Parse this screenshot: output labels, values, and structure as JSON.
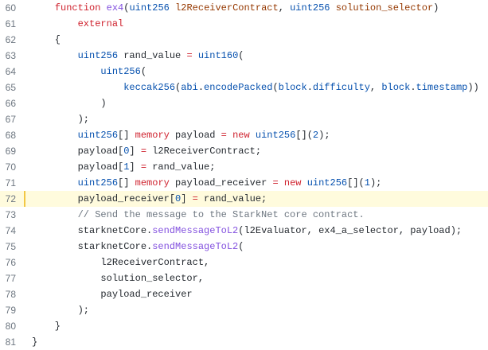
{
  "colors": {
    "keyword": "#cf222e",
    "type": "#0550ae",
    "function": "#8250df",
    "parameter": "#953800",
    "comment": "#6e7781",
    "plain": "#24292f",
    "line_number": "#6e7781",
    "highlight_background": "#fffbdd",
    "highlight_marker": "#f2c744"
  },
  "highlighted_line": "72",
  "lines": [
    {
      "num": "60",
      "tokens": [
        {
          "t": "    ",
          "c": "plain"
        },
        {
          "t": "function",
          "c": "keyword"
        },
        {
          "t": " ",
          "c": "plain"
        },
        {
          "t": "ex4",
          "c": "fn"
        },
        {
          "t": "(",
          "c": "plain"
        },
        {
          "t": "uint256",
          "c": "type"
        },
        {
          "t": " ",
          "c": "plain"
        },
        {
          "t": "l2ReceiverContract",
          "c": "param"
        },
        {
          "t": ", ",
          "c": "plain"
        },
        {
          "t": "uint256",
          "c": "type"
        },
        {
          "t": " ",
          "c": "plain"
        },
        {
          "t": "solution_selector",
          "c": "param"
        },
        {
          "t": ")",
          "c": "plain"
        }
      ]
    },
    {
      "num": "61",
      "tokens": [
        {
          "t": "        ",
          "c": "plain"
        },
        {
          "t": "external",
          "c": "keyword"
        }
      ]
    },
    {
      "num": "62",
      "tokens": [
        {
          "t": "    {",
          "c": "plain"
        }
      ]
    },
    {
      "num": "63",
      "tokens": [
        {
          "t": "        ",
          "c": "plain"
        },
        {
          "t": "uint256",
          "c": "type"
        },
        {
          "t": " rand_value ",
          "c": "plain"
        },
        {
          "t": "=",
          "c": "op"
        },
        {
          "t": " ",
          "c": "plain"
        },
        {
          "t": "uint160",
          "c": "type"
        },
        {
          "t": "(",
          "c": "plain"
        }
      ]
    },
    {
      "num": "64",
      "tokens": [
        {
          "t": "            ",
          "c": "plain"
        },
        {
          "t": "uint256",
          "c": "type"
        },
        {
          "t": "(",
          "c": "plain"
        }
      ]
    },
    {
      "num": "65",
      "tokens": [
        {
          "t": "                ",
          "c": "plain"
        },
        {
          "t": "keccak256",
          "c": "type"
        },
        {
          "t": "(",
          "c": "plain"
        },
        {
          "t": "abi",
          "c": "prop"
        },
        {
          "t": ".",
          "c": "plain"
        },
        {
          "t": "encodePacked",
          "c": "prop"
        },
        {
          "t": "(",
          "c": "plain"
        },
        {
          "t": "block",
          "c": "prop"
        },
        {
          "t": ".",
          "c": "plain"
        },
        {
          "t": "difficulty",
          "c": "prop"
        },
        {
          "t": ", ",
          "c": "plain"
        },
        {
          "t": "block",
          "c": "prop"
        },
        {
          "t": ".",
          "c": "plain"
        },
        {
          "t": "timestamp",
          "c": "prop"
        },
        {
          "t": "))",
          "c": "plain"
        }
      ]
    },
    {
      "num": "66",
      "tokens": [
        {
          "t": "            )",
          "c": "plain"
        }
      ]
    },
    {
      "num": "67",
      "tokens": [
        {
          "t": "        );",
          "c": "plain"
        }
      ]
    },
    {
      "num": "68",
      "tokens": [
        {
          "t": "        ",
          "c": "plain"
        },
        {
          "t": "uint256",
          "c": "type"
        },
        {
          "t": "[] ",
          "c": "plain"
        },
        {
          "t": "memory",
          "c": "keyword"
        },
        {
          "t": " payload ",
          "c": "plain"
        },
        {
          "t": "=",
          "c": "op"
        },
        {
          "t": " ",
          "c": "plain"
        },
        {
          "t": "new",
          "c": "keyword"
        },
        {
          "t": " ",
          "c": "plain"
        },
        {
          "t": "uint256",
          "c": "type"
        },
        {
          "t": "[](",
          "c": "plain"
        },
        {
          "t": "2",
          "c": "num"
        },
        {
          "t": ");",
          "c": "plain"
        }
      ]
    },
    {
      "num": "69",
      "tokens": [
        {
          "t": "        payload[",
          "c": "plain"
        },
        {
          "t": "0",
          "c": "num"
        },
        {
          "t": "] ",
          "c": "plain"
        },
        {
          "t": "=",
          "c": "op"
        },
        {
          "t": " l2ReceiverContract;",
          "c": "plain"
        }
      ]
    },
    {
      "num": "70",
      "tokens": [
        {
          "t": "        payload[",
          "c": "plain"
        },
        {
          "t": "1",
          "c": "num"
        },
        {
          "t": "] ",
          "c": "plain"
        },
        {
          "t": "=",
          "c": "op"
        },
        {
          "t": " rand_value;",
          "c": "plain"
        }
      ]
    },
    {
      "num": "71",
      "tokens": [
        {
          "t": "        ",
          "c": "plain"
        },
        {
          "t": "uint256",
          "c": "type"
        },
        {
          "t": "[] ",
          "c": "plain"
        },
        {
          "t": "memory",
          "c": "keyword"
        },
        {
          "t": " payload_receiver ",
          "c": "plain"
        },
        {
          "t": "=",
          "c": "op"
        },
        {
          "t": " ",
          "c": "plain"
        },
        {
          "t": "new",
          "c": "keyword"
        },
        {
          "t": " ",
          "c": "plain"
        },
        {
          "t": "uint256",
          "c": "type"
        },
        {
          "t": "[](",
          "c": "plain"
        },
        {
          "t": "1",
          "c": "num"
        },
        {
          "t": ");",
          "c": "plain"
        }
      ]
    },
    {
      "num": "72",
      "tokens": [
        {
          "t": "        payload_receiver[",
          "c": "plain"
        },
        {
          "t": "0",
          "c": "num"
        },
        {
          "t": "] ",
          "c": "plain"
        },
        {
          "t": "=",
          "c": "op"
        },
        {
          "t": " rand_value;",
          "c": "plain"
        }
      ]
    },
    {
      "num": "73",
      "tokens": [
        {
          "t": "        ",
          "c": "plain"
        },
        {
          "t": "// Send the message to the StarkNet core contract.",
          "c": "comment"
        }
      ]
    },
    {
      "num": "74",
      "tokens": [
        {
          "t": "        starknetCore.",
          "c": "plain"
        },
        {
          "t": "sendMessageToL2",
          "c": "fn"
        },
        {
          "t": "(l2Evaluator, ex4_a_selector, payload);",
          "c": "plain"
        }
      ]
    },
    {
      "num": "75",
      "tokens": [
        {
          "t": "        starknetCore.",
          "c": "plain"
        },
        {
          "t": "sendMessageToL2",
          "c": "fn"
        },
        {
          "t": "(",
          "c": "plain"
        }
      ]
    },
    {
      "num": "76",
      "tokens": [
        {
          "t": "            l2ReceiverContract,",
          "c": "plain"
        }
      ]
    },
    {
      "num": "77",
      "tokens": [
        {
          "t": "            solution_selector,",
          "c": "plain"
        }
      ]
    },
    {
      "num": "78",
      "tokens": [
        {
          "t": "            payload_receiver",
          "c": "plain"
        }
      ]
    },
    {
      "num": "79",
      "tokens": [
        {
          "t": "        );",
          "c": "plain"
        }
      ]
    },
    {
      "num": "80",
      "tokens": [
        {
          "t": "    }",
          "c": "plain"
        }
      ]
    },
    {
      "num": "81",
      "tokens": [
        {
          "t": "}",
          "c": "plain"
        }
      ]
    }
  ]
}
